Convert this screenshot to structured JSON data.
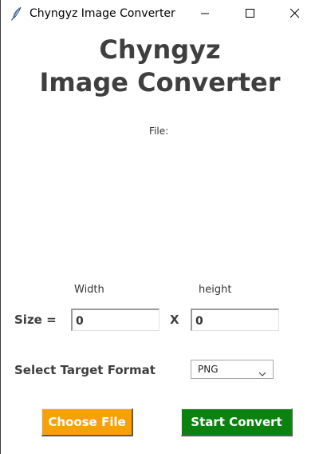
{
  "window": {
    "title": "Chyngyz Image Converter",
    "controls": {
      "minimize_icon": "minimize-icon",
      "maximize_icon": "maximize-icon",
      "close_icon": "close-icon"
    },
    "app_icon": "feather-icon"
  },
  "header": {
    "line1": "Chyngyz",
    "line2": "Image Converter"
  },
  "file": {
    "label": "File:"
  },
  "size": {
    "width_label": "Width",
    "height_label": "height",
    "size_label": "Size =",
    "x_label": "X",
    "width_value": "0",
    "height_value": "0"
  },
  "format": {
    "label": "Select Target Format",
    "selected": "PNG"
  },
  "buttons": {
    "choose_file": "Choose File",
    "start_convert": "Start Convert"
  },
  "colors": {
    "choose_button": "#f6a00a",
    "convert_button": "#0a8210",
    "heading_text": "#3f3f3f"
  }
}
